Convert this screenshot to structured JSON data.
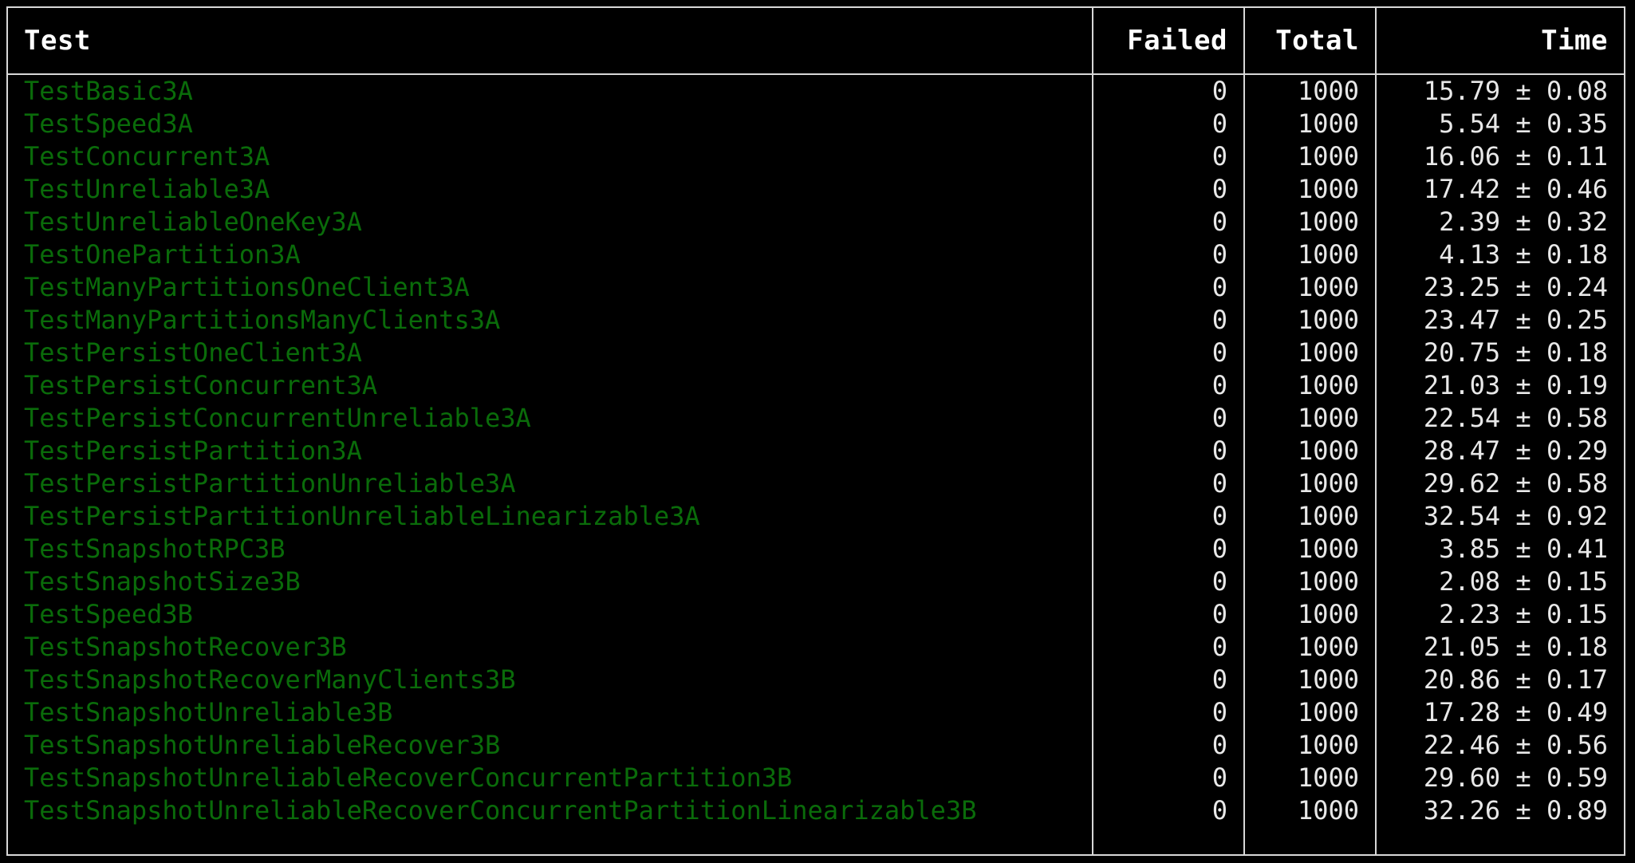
{
  "table": {
    "columns": [
      {
        "key": "test",
        "label": "Test",
        "align": "left"
      },
      {
        "key": "failed",
        "label": "Failed",
        "align": "right"
      },
      {
        "key": "total",
        "label": "Total",
        "align": "right"
      },
      {
        "key": "time",
        "label": "Time",
        "align": "right"
      }
    ],
    "colors": {
      "background": "#000000",
      "border": "#d8d8d8",
      "header_text": "#ffffff",
      "test_name_text": "#0a6b0a",
      "value_text": "#e8e8e8"
    },
    "rows": [
      {
        "test": "TestBasic3A",
        "failed": "0",
        "total": "1000",
        "time": "15.79 ± 0.08"
      },
      {
        "test": "TestSpeed3A",
        "failed": "0",
        "total": "1000",
        "time": " 5.54 ± 0.35"
      },
      {
        "test": "TestConcurrent3A",
        "failed": "0",
        "total": "1000",
        "time": "16.06 ± 0.11"
      },
      {
        "test": "TestUnreliable3A",
        "failed": "0",
        "total": "1000",
        "time": "17.42 ± 0.46"
      },
      {
        "test": "TestUnreliableOneKey3A",
        "failed": "0",
        "total": "1000",
        "time": " 2.39 ± 0.32"
      },
      {
        "test": "TestOnePartition3A",
        "failed": "0",
        "total": "1000",
        "time": " 4.13 ± 0.18"
      },
      {
        "test": "TestManyPartitionsOneClient3A",
        "failed": "0",
        "total": "1000",
        "time": "23.25 ± 0.24"
      },
      {
        "test": "TestManyPartitionsManyClients3A",
        "failed": "0",
        "total": "1000",
        "time": "23.47 ± 0.25"
      },
      {
        "test": "TestPersistOneClient3A",
        "failed": "0",
        "total": "1000",
        "time": "20.75 ± 0.18"
      },
      {
        "test": "TestPersistConcurrent3A",
        "failed": "0",
        "total": "1000",
        "time": "21.03 ± 0.19"
      },
      {
        "test": "TestPersistConcurrentUnreliable3A",
        "failed": "0",
        "total": "1000",
        "time": "22.54 ± 0.58"
      },
      {
        "test": "TestPersistPartition3A",
        "failed": "0",
        "total": "1000",
        "time": "28.47 ± 0.29"
      },
      {
        "test": "TestPersistPartitionUnreliable3A",
        "failed": "0",
        "total": "1000",
        "time": "29.62 ± 0.58"
      },
      {
        "test": "TestPersistPartitionUnreliableLinearizable3A",
        "failed": "0",
        "total": "1000",
        "time": "32.54 ± 0.92"
      },
      {
        "test": "TestSnapshotRPC3B",
        "failed": "0",
        "total": "1000",
        "time": " 3.85 ± 0.41"
      },
      {
        "test": "TestSnapshotSize3B",
        "failed": "0",
        "total": "1000",
        "time": " 2.08 ± 0.15"
      },
      {
        "test": "TestSpeed3B",
        "failed": "0",
        "total": "1000",
        "time": " 2.23 ± 0.15"
      },
      {
        "test": "TestSnapshotRecover3B",
        "failed": "0",
        "total": "1000",
        "time": "21.05 ± 0.18"
      },
      {
        "test": "TestSnapshotRecoverManyClients3B",
        "failed": "0",
        "total": "1000",
        "time": "20.86 ± 0.17"
      },
      {
        "test": "TestSnapshotUnreliable3B",
        "failed": "0",
        "total": "1000",
        "time": "17.28 ± 0.49"
      },
      {
        "test": "TestSnapshotUnreliableRecover3B",
        "failed": "0",
        "total": "1000",
        "time": "22.46 ± 0.56"
      },
      {
        "test": "TestSnapshotUnreliableRecoverConcurrentPartition3B",
        "failed": "0",
        "total": "1000",
        "time": "29.60 ± 0.59"
      },
      {
        "test": "TestSnapshotUnreliableRecoverConcurrentPartitionLinearizable3B",
        "failed": "0",
        "total": "1000",
        "time": "32.26 ± 0.89"
      }
    ]
  }
}
